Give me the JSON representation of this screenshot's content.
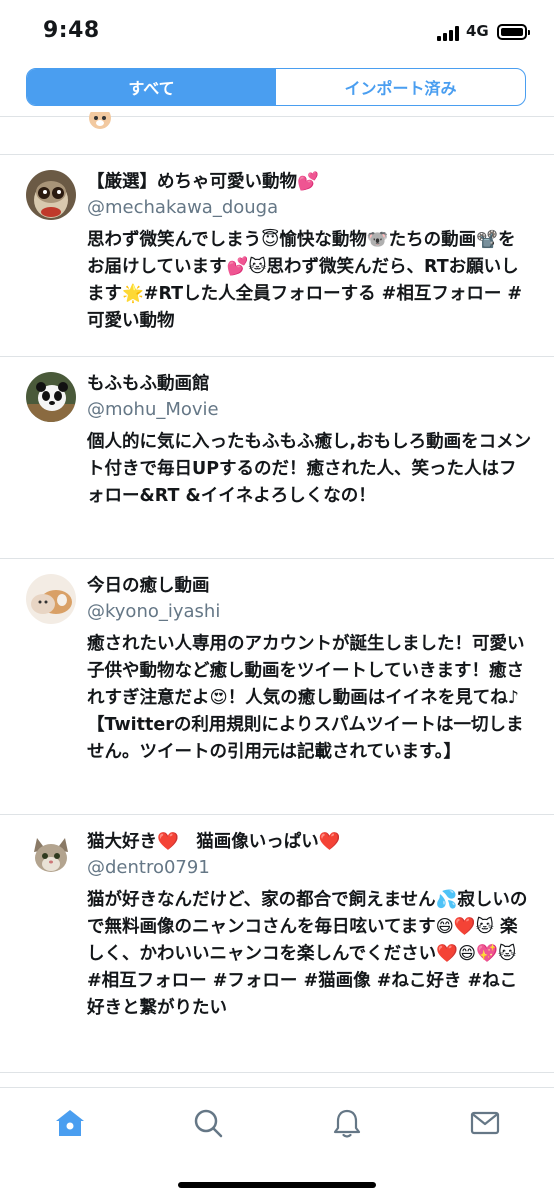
{
  "status_bar": {
    "time": "9:48",
    "network": "4G"
  },
  "segmented": {
    "all": "すべて",
    "imported": "インポート済み"
  },
  "accounts": [
    {
      "name": "【厳選】めちゃ可愛い動物💕",
      "handle": "@mechakawa_douga",
      "bio": "思わず微笑んでしまう😇愉快な動物🐨たちの動画📽️をお届けしています💕🐱思わず微笑んだら、RTお願いします🌟#RTした人全員フォローする #相互フォロー # 可愛い動物"
    },
    {
      "name": "もふもふ動画館",
      "handle": "@mohu_Movie",
      "bio": "個人的に気に入ったもふもふ癒し,おもしろ動画をコメント付きで毎日UPするのだ！癒された人、笑った人はフォロー&RT &イイネよろしくなの！"
    },
    {
      "name": "今日の癒し動画",
      "handle": "@kyono_iyashi",
      "bio": "癒されたい人専用のアカウントが誕生しました！可愛い子供や動物など癒し動画をツイートしていきます！癒されすぎ注意だよ😍！人気の癒し動画はイイネを見てね♪ 【Twitterの利用規則によりスパムツイートは一切しません。ツイートの引用元は記載されています。】"
    },
    {
      "name": "猫大好き❤️　猫画像いっぱい❤️",
      "handle": "@dentro0791",
      "bio": "猫が好きなんだけど、家の都合で飼えません💦寂しいので無料画像のニャンコさんを毎日呟いてます😄❤️🐱 楽しく、かわいいニャンコを楽しんでください❤️😄💖🐱 #相互フォロー #フォロー #猫画像 #ねこ好き #ねこ好きと繋がりたい"
    }
  ],
  "tabbar": {
    "icons": [
      "home-icon",
      "search-icon",
      "notifications-icon",
      "messages-icon"
    ],
    "active_color": "#4a9ef0"
  }
}
